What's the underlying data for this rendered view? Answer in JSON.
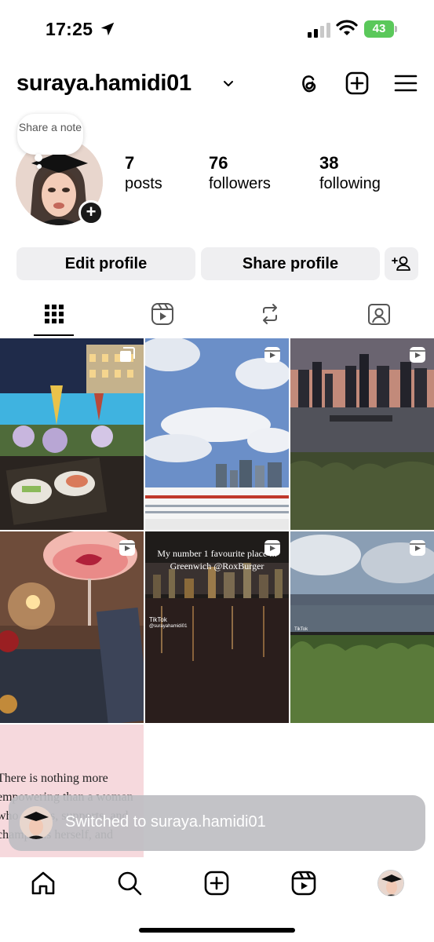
{
  "status_bar": {
    "time": "17:25",
    "battery": "43"
  },
  "header": {
    "username": "suraya.hamidi01",
    "icons": [
      "threads-icon",
      "new-post-icon",
      "menu-icon"
    ]
  },
  "profile": {
    "note": "Share a note",
    "posts_count": "7",
    "posts_label": "posts",
    "followers_count": "76",
    "followers_label": "followers",
    "following_count": "38",
    "following_label": "following"
  },
  "buttons": {
    "edit_profile": "Edit profile",
    "share_profile": "Share profile"
  },
  "tabs": [
    "grid-tab",
    "reels-tab",
    "reposts-tab",
    "tagged-tab"
  ],
  "grid": {
    "reel_text": "My number 1 favourite place in Greenwich @RoxBurger",
    "tiktok_label": "TikTok",
    "tiktok_handle": "@surayahamidi01",
    "quote_text": "There is nothing more empowering than a woman who speaks, supports, and champions herself, and"
  },
  "toast": {
    "text": "Switched to suraya.hamidi01"
  },
  "bottom_nav": [
    "home-icon",
    "search-icon",
    "create-icon",
    "reels-icon",
    "profile-avatar"
  ],
  "colors": {
    "button_bg": "#efeff1",
    "battery": "#5ac85a",
    "toast_bg": "#bebec2"
  }
}
